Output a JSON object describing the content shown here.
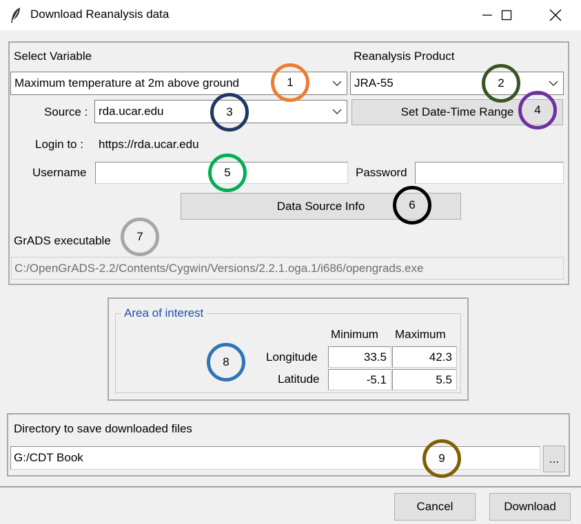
{
  "window": {
    "title": "Download Reanalysis data"
  },
  "top_panel": {
    "select_variable_label": "Select Variable",
    "variable_value": "Maximum temperature at 2m above ground",
    "reanalysis_product_label": "Reanalysis Product",
    "product_value": "JRA-55",
    "source_label": "Source :",
    "source_value": "rda.ucar.edu",
    "set_date_button": "Set Date-Time Range",
    "login_label": "Login to :",
    "login_url": "https://rda.ucar.edu",
    "username_label": "Username",
    "username_value": "",
    "password_label": "Password",
    "password_value": "",
    "data_source_info_button": "Data Source Info",
    "grads_label": "GrADS executable",
    "grads_path": "C:/OpenGrADS-2.2/Contents/Cygwin/Versions/2.2.1.oga.1/i686/opengrads.exe"
  },
  "area": {
    "title": "Area of interest",
    "col_min": "Minimum",
    "col_max": "Maximum",
    "longitude_label": "Longitude",
    "latitude_label": "Latitude",
    "lon_min": "33.5",
    "lon_max": "42.3",
    "lat_min": "-5.1",
    "lat_max": "5.5"
  },
  "directory": {
    "label": "Directory to save downloaded files",
    "value": "G:/CDT Book",
    "browse_button": "..."
  },
  "footer": {
    "cancel_button": "Cancel",
    "download_button": "Download"
  },
  "markers": [
    {
      "num": "1",
      "color": "#ed7d31"
    },
    {
      "num": "2",
      "color": "#375623"
    },
    {
      "num": "3",
      "color": "#1f3864"
    },
    {
      "num": "4",
      "color": "#7030a0"
    },
    {
      "num": "5",
      "color": "#00b050"
    },
    {
      "num": "6",
      "color": "#000000"
    },
    {
      "num": "7",
      "color": "#a6a6a6"
    },
    {
      "num": "8",
      "color": "#2e75b6"
    },
    {
      "num": "9",
      "color": "#7f6000"
    }
  ]
}
